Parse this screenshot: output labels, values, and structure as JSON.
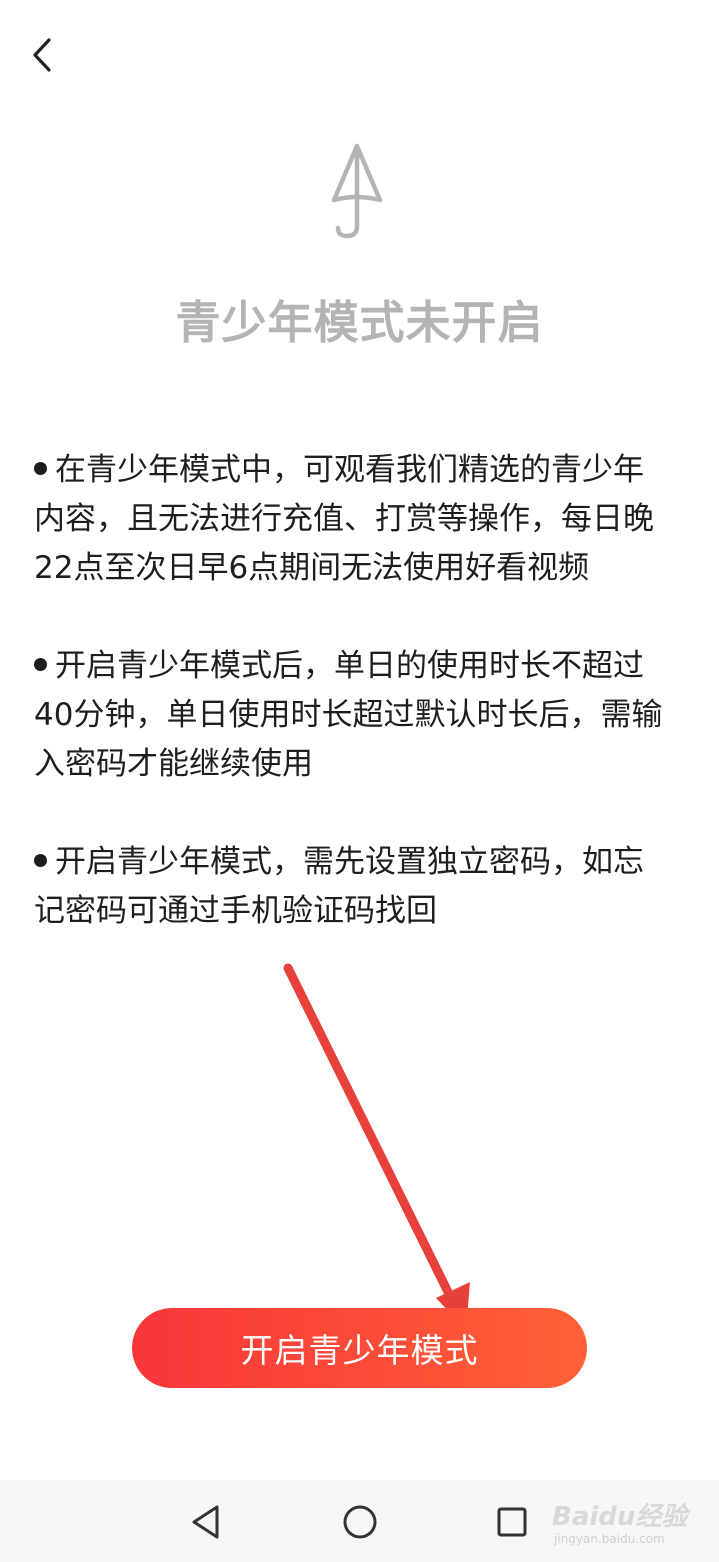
{
  "header": {
    "back_icon": "chevron-left-icon"
  },
  "hero": {
    "icon": "umbrella-closed-icon",
    "icon_color": "#b4b4b4"
  },
  "title": "青少年模式未开启",
  "paragraphs": [
    {
      "lines": [
        "在青少年模式中，可观看我们精选的青少年",
        "内容，且无法进行充值、打赏等操作，每日晚",
        "22点至次日早6点期间无法使用好看视频"
      ]
    },
    {
      "lines": [
        "开启青少年模式后，单日的使用时长不超过",
        "40分钟，单日使用时长超过默认时长后，需输",
        "入密码才能继续使用"
      ]
    },
    {
      "lines": [
        "开启青少年模式，需先设置独立密码，如忘",
        "记密码可通过手机验证码找回"
      ]
    }
  ],
  "cta": {
    "label": "开启青少年模式",
    "gradient_start": "#f8363a",
    "gradient_end": "#ff6036"
  },
  "annotation": {
    "type": "arrow",
    "color": "#e8403a"
  },
  "navbar": {
    "back_icon": "triangle-back-icon",
    "home_icon": "circle-home-icon",
    "recents_icon": "square-recents-icon"
  },
  "watermark": {
    "logo_text": "Baidu经验",
    "sub_text": "jingyan.baidu.com"
  }
}
